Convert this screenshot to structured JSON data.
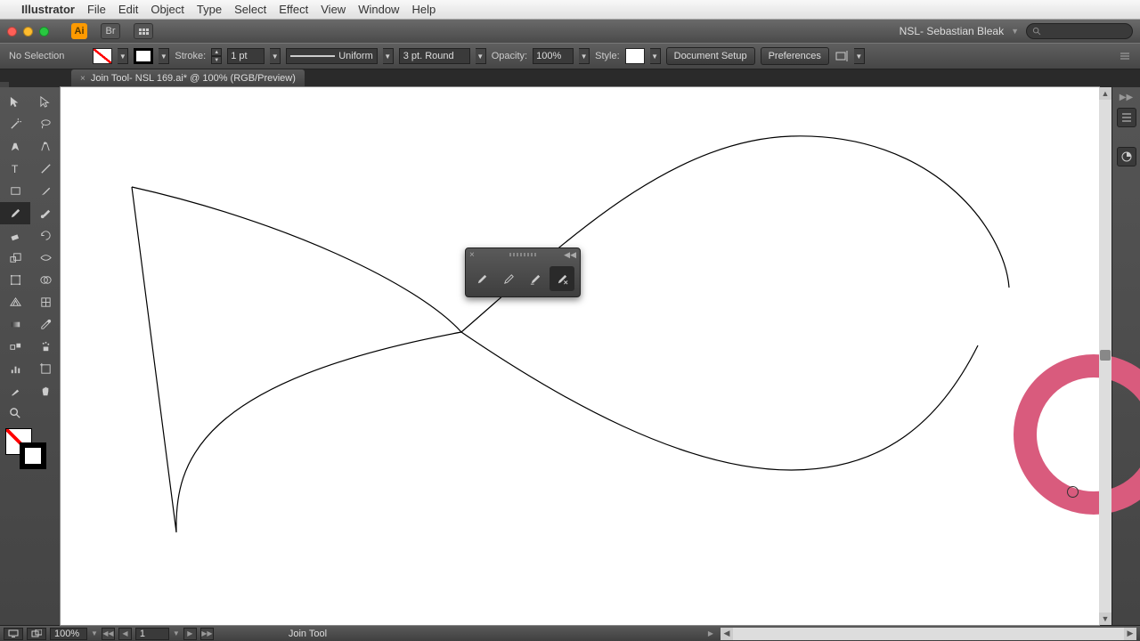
{
  "menubar": {
    "app": "Illustrator",
    "items": [
      "File",
      "Edit",
      "Object",
      "Type",
      "Select",
      "Effect",
      "View",
      "Window",
      "Help"
    ]
  },
  "titlebar": {
    "username": "NSL- Sebastian Bleak"
  },
  "controlbar": {
    "selection": "No Selection",
    "stroke_label": "Stroke:",
    "stroke_weight": "1 pt",
    "profile": "Uniform",
    "brush": "3 pt. Round",
    "opacity_label": "Opacity:",
    "opacity_value": "100%",
    "style_label": "Style:",
    "doc_setup": "Document Setup",
    "preferences": "Preferences"
  },
  "document": {
    "tab_label": "Join Tool- NSL 169.ai* @ 100% (RGB/Preview)"
  },
  "statusbar": {
    "zoom": "100%",
    "page": "1",
    "tool": "Join Tool"
  },
  "colors": {
    "ring": "#d95b7d",
    "ring_dark": "#b0285a"
  }
}
